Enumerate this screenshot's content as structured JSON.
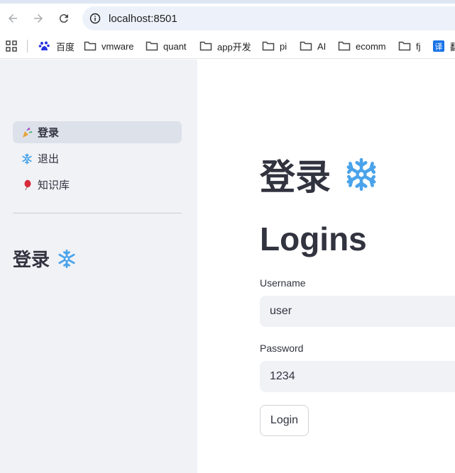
{
  "browser": {
    "url": "localhost:8501",
    "bookmarks": [
      {
        "label": "百度",
        "icon": "baidu-icon"
      },
      {
        "label": "vmware",
        "icon": "folder-icon"
      },
      {
        "label": "quant",
        "icon": "folder-icon"
      },
      {
        "label": "app开发",
        "icon": "folder-icon"
      },
      {
        "label": "pi",
        "icon": "folder-icon"
      },
      {
        "label": "AI",
        "icon": "folder-icon"
      },
      {
        "label": "ecomm",
        "icon": "folder-icon"
      },
      {
        "label": "fj",
        "icon": "folder-icon"
      },
      {
        "label": "翻",
        "icon": "translate-icon"
      }
    ]
  },
  "sidebar": {
    "items": [
      {
        "label": "登录",
        "icon": "party-popper-icon",
        "active": true
      },
      {
        "label": "退出",
        "icon": "snowflake-icon",
        "active": false
      },
      {
        "label": "知识库",
        "icon": "balloon-icon",
        "active": false
      }
    ],
    "title": "登录"
  },
  "main": {
    "title": "登录",
    "subtitle": "Logins",
    "username_label": "Username",
    "username_value": "user",
    "password_label": "Password",
    "password_value": "1234",
    "login_button": "Login"
  },
  "colors": {
    "sidebar_bg": "#f0f2f6",
    "active_item_bg": "#dde1ea",
    "text": "#31333f",
    "snowflake": "#4aa3ea"
  }
}
